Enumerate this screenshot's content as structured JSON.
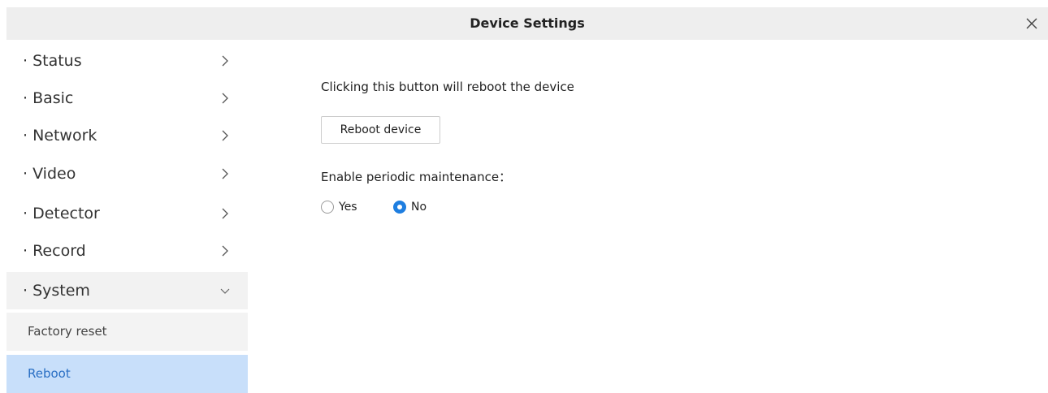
{
  "window": {
    "title": "Device Settings",
    "close_icon": "close-icon"
  },
  "sidebar": {
    "items": [
      {
        "label": "· Status",
        "arrow": "chevron-right-icon"
      },
      {
        "label": "· Basic",
        "arrow": "chevron-right-icon"
      },
      {
        "label": "· Network",
        "arrow": "chevron-right-icon"
      },
      {
        "label": "· Video",
        "arrow": "chevron-right-icon"
      },
      {
        "label": "· Detector",
        "arrow": "chevron-right-icon"
      },
      {
        "label": "· Record",
        "arrow": "chevron-right-icon"
      },
      {
        "label": "· System",
        "arrow": "chevron-down-icon",
        "expanded": true
      }
    ],
    "sub_items": [
      {
        "label": "Factory reset"
      },
      {
        "label": "Reboot",
        "active": true
      }
    ]
  },
  "main": {
    "description": "Clicking this button will reboot the device",
    "reboot_button_label": "Reboot device",
    "maintenance_label": "Enable periodic maintenance：",
    "maintenance_options": [
      {
        "label": "Yes",
        "selected": false
      },
      {
        "label": "No",
        "selected": true
      }
    ]
  },
  "colors": {
    "titlebar_bg": "#eeeeee",
    "active_item_bg": "#c8dffa",
    "active_item_text": "#2a6fc4",
    "radio_selected": "#1e7ee0"
  }
}
